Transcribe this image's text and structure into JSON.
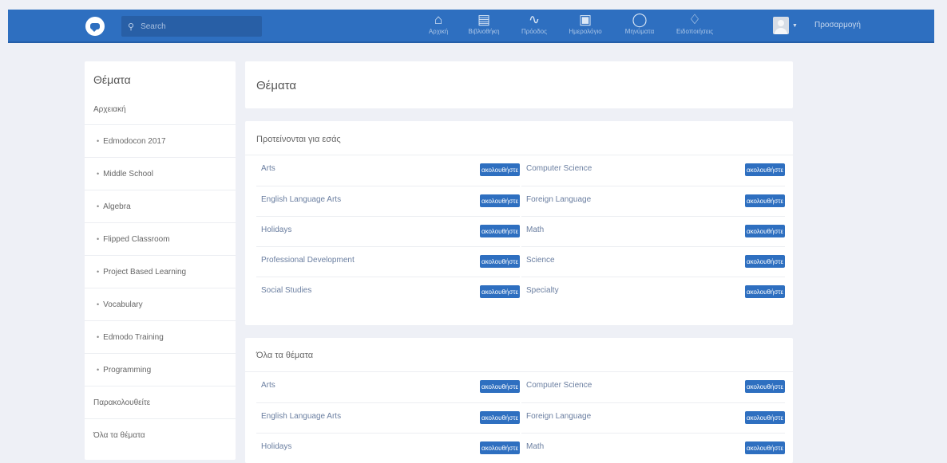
{
  "header": {
    "search_placeholder": "Search",
    "nav": [
      {
        "icon": "home-icon",
        "glyph": "⌂",
        "label": "Αρχική"
      },
      {
        "icon": "notebook-icon",
        "glyph": "▤",
        "label": "Βιβλιοθήκη"
      },
      {
        "icon": "activity-icon",
        "glyph": "∿",
        "label": "Πρόοδος"
      },
      {
        "icon": "calendar-icon",
        "glyph": "▣",
        "label": "Ημερολόγιο"
      },
      {
        "icon": "messages-icon",
        "glyph": "◯",
        "label": "Μηνύματα"
      },
      {
        "icon": "bell-icon",
        "glyph": "♢",
        "label": "Ειδοποιήσεις"
      }
    ],
    "username": "Προσαρμογή"
  },
  "sidebar": {
    "title": "Θέματα",
    "items": [
      {
        "label": "Αρχειακή",
        "sub": false
      },
      {
        "label": "Edmodocon 2017",
        "sub": true
      },
      {
        "label": "Middle School",
        "sub": true
      },
      {
        "label": "Algebra",
        "sub": true
      },
      {
        "label": "Flipped Classroom",
        "sub": true
      },
      {
        "label": "Project Based Learning",
        "sub": true
      },
      {
        "label": "Vocabulary",
        "sub": true
      },
      {
        "label": "Edmodo Training",
        "sub": true
      },
      {
        "label": "Programming",
        "sub": true
      },
      {
        "label": "Παρακολουθείτε",
        "sub": false
      },
      {
        "label": "Όλα τα θέματα",
        "sub": false
      }
    ]
  },
  "main": {
    "title": "Θέματα",
    "follow_label": "ακολουθήστε",
    "recommended": {
      "title": "Προτείνονται για εσάς",
      "left": [
        "Arts",
        "English Language Arts",
        "Holidays",
        "Professional Development",
        "Social Studies"
      ],
      "right": [
        "Computer Science",
        "Foreign Language",
        "Math",
        "Science",
        "Specialty"
      ]
    },
    "all": {
      "title": "Όλα τα θέματα",
      "left": [
        "Arts",
        "English Language Arts",
        "Holidays"
      ],
      "right": [
        "Computer Science",
        "Foreign Language",
        "Math"
      ]
    }
  }
}
